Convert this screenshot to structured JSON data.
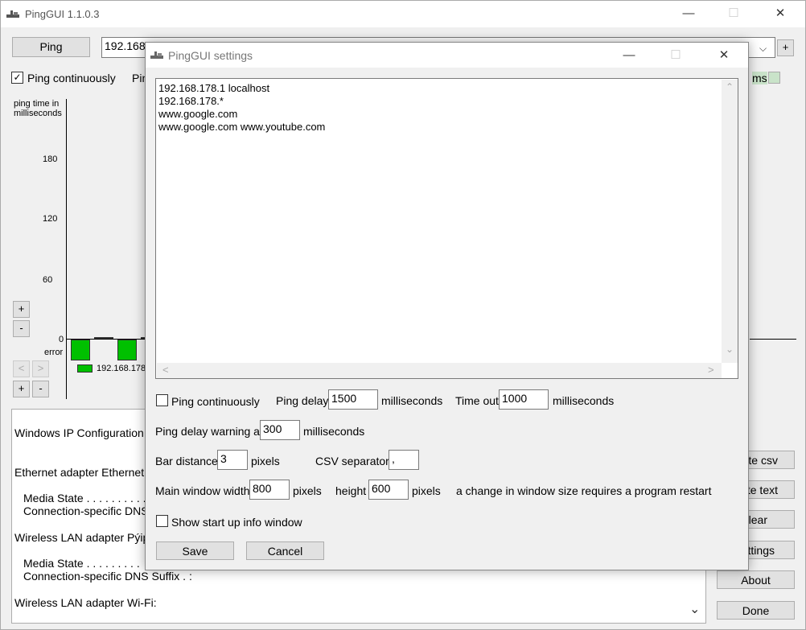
{
  "main": {
    "title": "PingGUI 1.1.0.3",
    "ping_button": "Ping",
    "host_value": "192.168",
    "add_button": "+",
    "ping_continuously_label": "Ping continuously",
    "ping_continuously_checked": true,
    "partial_label": "Pin",
    "legend_right_label": "ms",
    "chart": {
      "ylabel": "ping time in milliseconds",
      "ticks": [
        "180",
        "120",
        "60",
        "0"
      ],
      "error_label": "error",
      "zoom_in": "+",
      "zoom_out": "-",
      "series_name": "192.168.178",
      "scroll_left": "<",
      "scroll_right": ">",
      "width_plus": "+",
      "width_minus": "-"
    },
    "chart_data": {
      "type": "bar",
      "ylabel": "ping time in milliseconds",
      "ylim": [
        0,
        200
      ],
      "ticks": [
        0,
        60,
        120,
        180
      ],
      "series": [
        {
          "name": "192.168.178",
          "values": [
            "error",
            0,
            "error",
            0
          ]
        }
      ]
    },
    "output": {
      "lines": [
        "Windows IP Configuration",
        "Ethernet adapter Ethernet:",
        "Media State . . . . . . . . . .",
        "Connection-specific DNS",
        "Wireless LAN adapter Pýipo",
        "Media State . . . . . . . . .",
        "Connection-specific DNS Suffix  . :",
        "Wireless LAN adapter Wi-Fi:"
      ],
      "scroll_down": "⌄"
    },
    "side_buttons": [
      "te csv",
      "te text",
      "lear",
      "ttings",
      "About",
      "Done"
    ]
  },
  "dialog": {
    "title": "PingGUI settings",
    "hosts": [
      "192.168.178.1 localhost",
      "192.168.178.*",
      "www.google.com",
      "www.google.com www.youtube.com"
    ],
    "ping_continuously_label": "Ping continuously",
    "ping_continuously_checked": false,
    "ping_delay_label": "Ping delay",
    "ping_delay_value": "1500",
    "ms1": "milliseconds",
    "timeout_label": "Time out",
    "timeout_value": "1000",
    "ms2": "milliseconds",
    "warning_label": "Ping delay warning at",
    "warning_value": "300",
    "ms3": "milliseconds",
    "bar_distance_label": "Bar distance",
    "bar_distance_value": "3",
    "pixels1": "pixels",
    "csv_label": "CSV separator",
    "csv_value": ",",
    "width_label": "Main window width",
    "width_value": "800",
    "pixels2": "pixels",
    "height_label": "height",
    "height_value": "600",
    "pixels3": "pixels",
    "restart_note": "a change in window size requires a program restart",
    "startup_label": "Show start up info window",
    "startup_checked": false,
    "save_button": "Save",
    "cancel_button": "Cancel"
  }
}
